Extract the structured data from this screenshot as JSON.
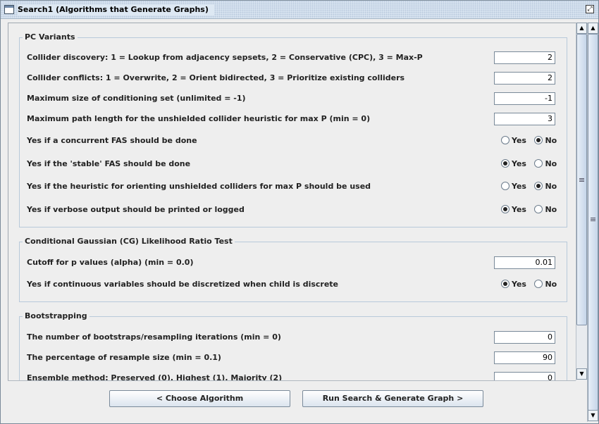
{
  "window": {
    "title": "Search1 (Algorithms that Generate Graphs)"
  },
  "sections": {
    "pc": {
      "title": "PC Variants",
      "rows": [
        {
          "label": "Collider discovery: 1 = Lookup from adjacency sepsets, 2 = Conservative (CPC), 3 = Max-P",
          "value": "2"
        },
        {
          "label": "Collider conflicts: 1 = Overwrite, 2 = Orient bidirected, 3 = Prioritize existing colliders",
          "value": "2"
        },
        {
          "label": "Maximum size of conditioning set (unlimited = -1)",
          "value": "-1"
        },
        {
          "label": "Maximum path length for the unshielded collider heuristic for max P (min = 0)",
          "value": "3"
        },
        {
          "label": "Yes if a concurrent FAS should be done",
          "yes": "Yes",
          "no": "No",
          "selected": "No"
        },
        {
          "label": "Yes if the 'stable' FAS should be done",
          "yes": "Yes",
          "no": "No",
          "selected": "Yes"
        },
        {
          "label": "Yes if the heuristic for orienting unshielded colliders for max P should be used",
          "yes": "Yes",
          "no": "No",
          "selected": "No"
        },
        {
          "label": "Yes if verbose output should be printed or logged",
          "yes": "Yes",
          "no": "No",
          "selected": "Yes"
        }
      ]
    },
    "cg": {
      "title": "Conditional Gaussian (CG) Likelihood Ratio Test",
      "rows": [
        {
          "label": "Cutoff for p values (alpha) (min = 0.0)",
          "value": "0.01"
        },
        {
          "label": "Yes if continuous variables should be discretized when child is discrete",
          "yes": "Yes",
          "no": "No",
          "selected": "Yes"
        }
      ]
    },
    "boot": {
      "title": "Bootstrapping",
      "rows": [
        {
          "label": "The number of bootstraps/resampling iterations (min = 0)",
          "value": "0"
        },
        {
          "label": "The percentage of resample size (min = 0.1)",
          "value": "90"
        },
        {
          "label": "Ensemble method: Preserved (0), Highest (1), Majority (2)",
          "value": "0"
        }
      ]
    }
  },
  "buttons": {
    "choose": "<  Choose Algorithm",
    "run": "Run Search & Generate Graph  >"
  },
  "icons": {
    "window": "window-icon",
    "maximize": "maximize-icon",
    "up": "scroll-up-arrow-icon",
    "down": "scroll-down-arrow-icon"
  },
  "colors": {
    "titlebar": "#dde8f3",
    "panel": "#eeeeee",
    "section_border": "#b8c9da"
  }
}
